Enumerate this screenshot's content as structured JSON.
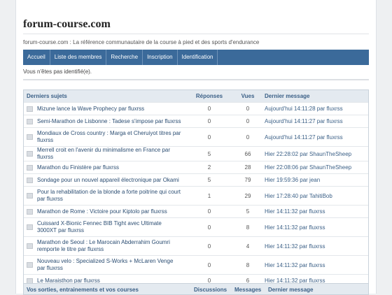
{
  "site": {
    "title": "forum-course.com",
    "tagline": "forum-course.com : La référence communautaire de la course à pied et des sports d'endurance"
  },
  "nav": [
    "Accueil",
    "Liste des membres",
    "Recherche",
    "Inscription",
    "Identification"
  ],
  "notice": "Vous n'êtes pas identifié(e).",
  "table": {
    "headers": [
      "Derniers sujets",
      "Réponses",
      "Vues",
      "Dernier message"
    ],
    "rows": [
      {
        "topic": "Mizune lance la Wave Prophecy par fluxrss",
        "replies": "0",
        "views": "0",
        "last": "Aujourd'hui 14:11:28 par fluxrss"
      },
      {
        "topic": "Semi-Marathon de Lisbonne : Tadese s'impose par fluxrss",
        "replies": "0",
        "views": "0",
        "last": "Aujourd'hui 14:11:27 par fluxrss"
      },
      {
        "topic": "Mondiaux de Cross country : Marga et Cheruiyot titres par fluxrss",
        "replies": "0",
        "views": "0",
        "last": "Aujourd'hui 14:11:27 par fluxrss"
      },
      {
        "topic": "Merrell croit en l'avenir du minimalisme en France par fluxrss",
        "replies": "5",
        "views": "66",
        "last": "Hier 22:28:02 par ShaunTheSheep"
      },
      {
        "topic": "Marathon du Finistère par fluxrss",
        "replies": "2",
        "views": "28",
        "last": "Hier 22:08:06 par ShaunTheSheep"
      },
      {
        "topic": "Sondage pour un nouvel appareil électronique par Okami",
        "replies": "5",
        "views": "79",
        "last": "Hier 19:59:36 par jean"
      },
      {
        "topic": "Pour la rehabilitation de la blonde a forte poitrine qui court par fluxrss",
        "replies": "1",
        "views": "29",
        "last": "Hier 17:28:40 par TahitiBob"
      },
      {
        "topic": "Marathon de Rome : Victoire pour Kiptolo par fluxrss",
        "replies": "0",
        "views": "5",
        "last": "Hier 14:11:32 par fluxrss"
      },
      {
        "topic": "Cuissard X-Bionic Fennec BIB Tight avec Ultimate 3000XT par fluxrss",
        "replies": "0",
        "views": "8",
        "last": "Hier 14:11:32 par fluxrss"
      },
      {
        "topic": "Marathon de Seoul : Le Marocain Abderrahim Goumri remporte le titre par fluxrss",
        "replies": "0",
        "views": "4",
        "last": "Hier 14:11:32 par fluxrss"
      },
      {
        "topic": "Nouveau velo : Specialized S-Works + McLaren Venge par fluxrss",
        "replies": "0",
        "views": "8",
        "last": "Hier 14:11:32 par fluxrss"
      },
      {
        "topic": "Le Maraisthon par fluxrss",
        "replies": "0",
        "views": "6",
        "last": "Hier 14:11:32 par fluxrss"
      }
    ]
  },
  "footer": {
    "section": "Vos sorties, entrainements et vos courses",
    "discussions": "Discussions",
    "messages": "Messages",
    "last": "Dernier message"
  }
}
